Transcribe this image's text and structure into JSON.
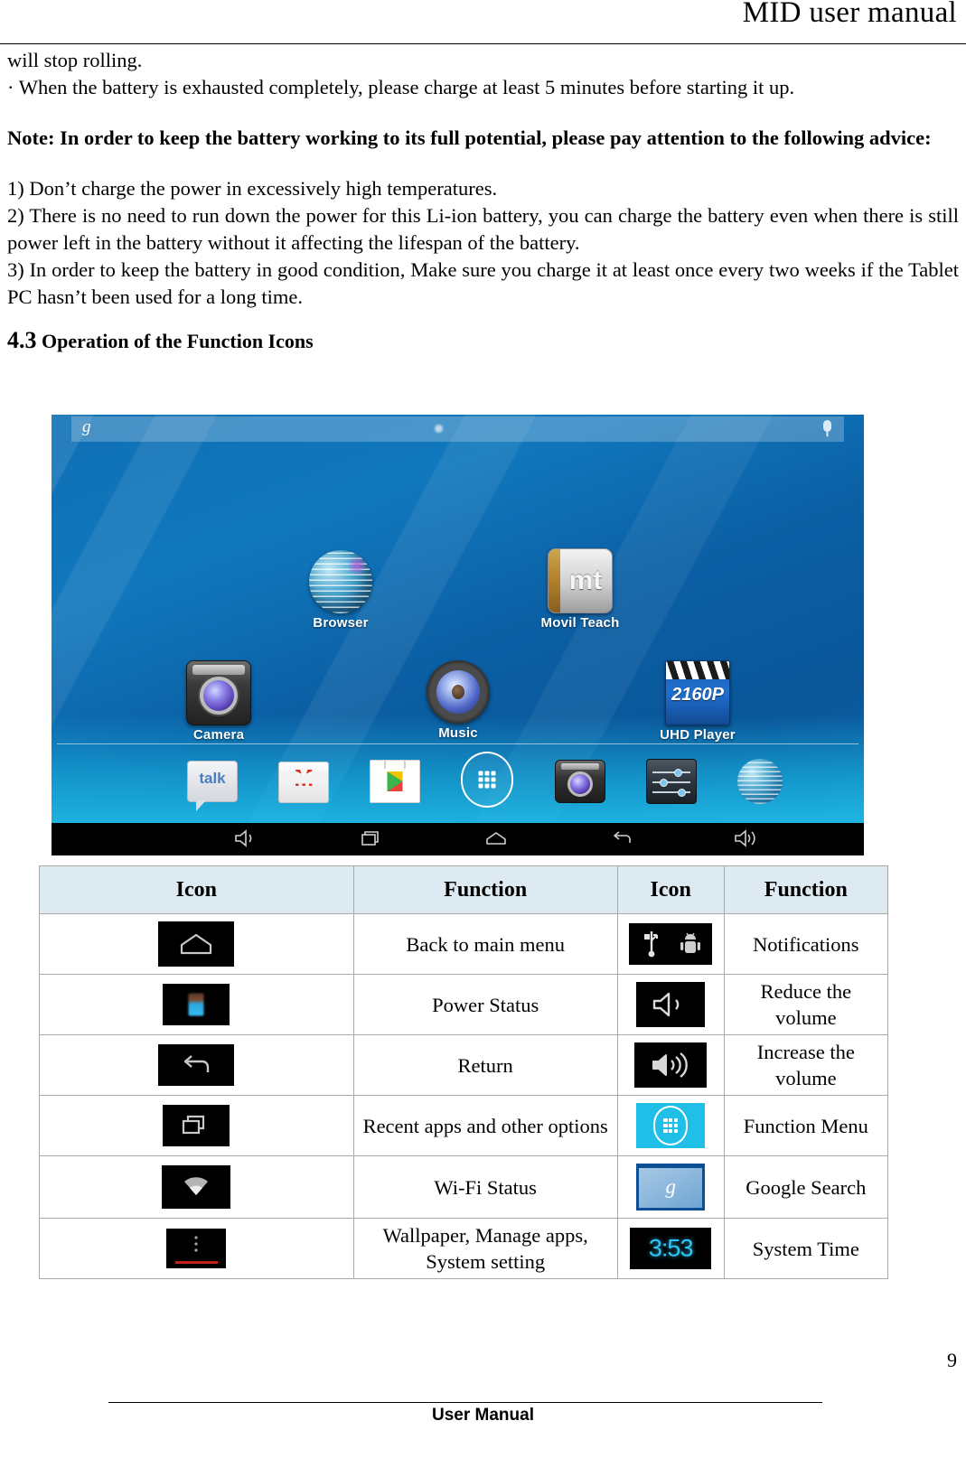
{
  "header": {
    "title": "MID user manual"
  },
  "body_text": {
    "line1": "will stop rolling.",
    "line2": "· When the battery is exhausted completely, please charge at least 5 minutes before starting it up.",
    "note": "Note: In order to keep the battery working to its full potential, please pay attention to the following advice:",
    "item1": "1) Don’t charge the power in excessively high temperatures.",
    "item2": "2) There is no need to run down the power for this Li-ion battery, you can charge the battery even when there is still power left in the battery without it affecting the lifespan of the battery.",
    "item3": "3) In order to keep the battery in good condition, Make sure you charge it at least once every two weeks if the Tablet PC hasn’t been used for a long time."
  },
  "section": {
    "number": "4.3",
    "title": "Operation of the Function Icons"
  },
  "screenshot": {
    "statusbar": {
      "google_glyph": "g",
      "mic_icon": "microphone-icon"
    },
    "apps": [
      {
        "label": "Browser",
        "icon": "globe-icon"
      },
      {
        "label": "Movil Teach",
        "icon": "movil-teach-icon",
        "badge": "mt"
      },
      {
        "label": "Camera",
        "icon": "camera-icon"
      },
      {
        "label": "Music",
        "icon": "speaker-icon"
      },
      {
        "label": "UHD Player",
        "icon": "clapperboard-icon",
        "badge": "2160P"
      }
    ],
    "dock": [
      {
        "name": "talk",
        "icon": "talk-icon",
        "label": "talk"
      },
      {
        "name": "gmail",
        "icon": "gmail-icon",
        "label": "M"
      },
      {
        "name": "play-store",
        "icon": "play-store-icon"
      },
      {
        "name": "app-drawer",
        "icon": "app-drawer-icon"
      },
      {
        "name": "camera",
        "icon": "camera-icon"
      },
      {
        "name": "settings",
        "icon": "sliders-icon"
      },
      {
        "name": "browser",
        "icon": "globe-icon"
      }
    ],
    "navbar": [
      {
        "name": "volume-down",
        "icon": "volume-down-icon"
      },
      {
        "name": "recent-apps",
        "icon": "recent-apps-icon"
      },
      {
        "name": "home",
        "icon": "home-icon"
      },
      {
        "name": "back",
        "icon": "back-icon"
      },
      {
        "name": "volume-up",
        "icon": "volume-up-icon"
      }
    ]
  },
  "table": {
    "headers": [
      "Icon",
      "Function",
      "Icon",
      "Function"
    ],
    "rows": [
      {
        "left_icon": "home-icon",
        "left_function": "Back to main menu",
        "right_icon": "usb-android-icon",
        "right_function": "Notifications"
      },
      {
        "left_icon": "battery-icon",
        "left_function": "Power Status",
        "right_icon": "volume-down-icon",
        "right_function": "Reduce the volume"
      },
      {
        "left_icon": "back-icon",
        "left_function": "Return",
        "right_icon": "volume-up-icon",
        "right_function": "Increase the volume"
      },
      {
        "left_icon": "recent-apps-icon",
        "left_function": "Recent apps and other options",
        "right_icon": "app-drawer-icon",
        "right_function": "Function Menu"
      },
      {
        "left_icon": "wifi-icon",
        "left_function": "Wi-Fi Status",
        "right_icon": "google-search-icon",
        "right_function": "Google Search",
        "right_icon_glyph": "g"
      },
      {
        "left_icon": "overflow-menu-icon",
        "left_function": "Wallpaper, Manage apps, System setting",
        "right_icon": "clock-icon",
        "right_function": "System Time",
        "right_icon_glyph": "3:53"
      }
    ]
  },
  "footer": {
    "page_number": "9",
    "text": "User Manual"
  },
  "colors": {
    "table_header_bg": "#ddeaf2",
    "table_border": "#a9a9a9",
    "wallpaper_blue": "#0f6fb4",
    "accent_cyan": "#1fbfe8",
    "clock_cyan": "#2fc6f5"
  }
}
